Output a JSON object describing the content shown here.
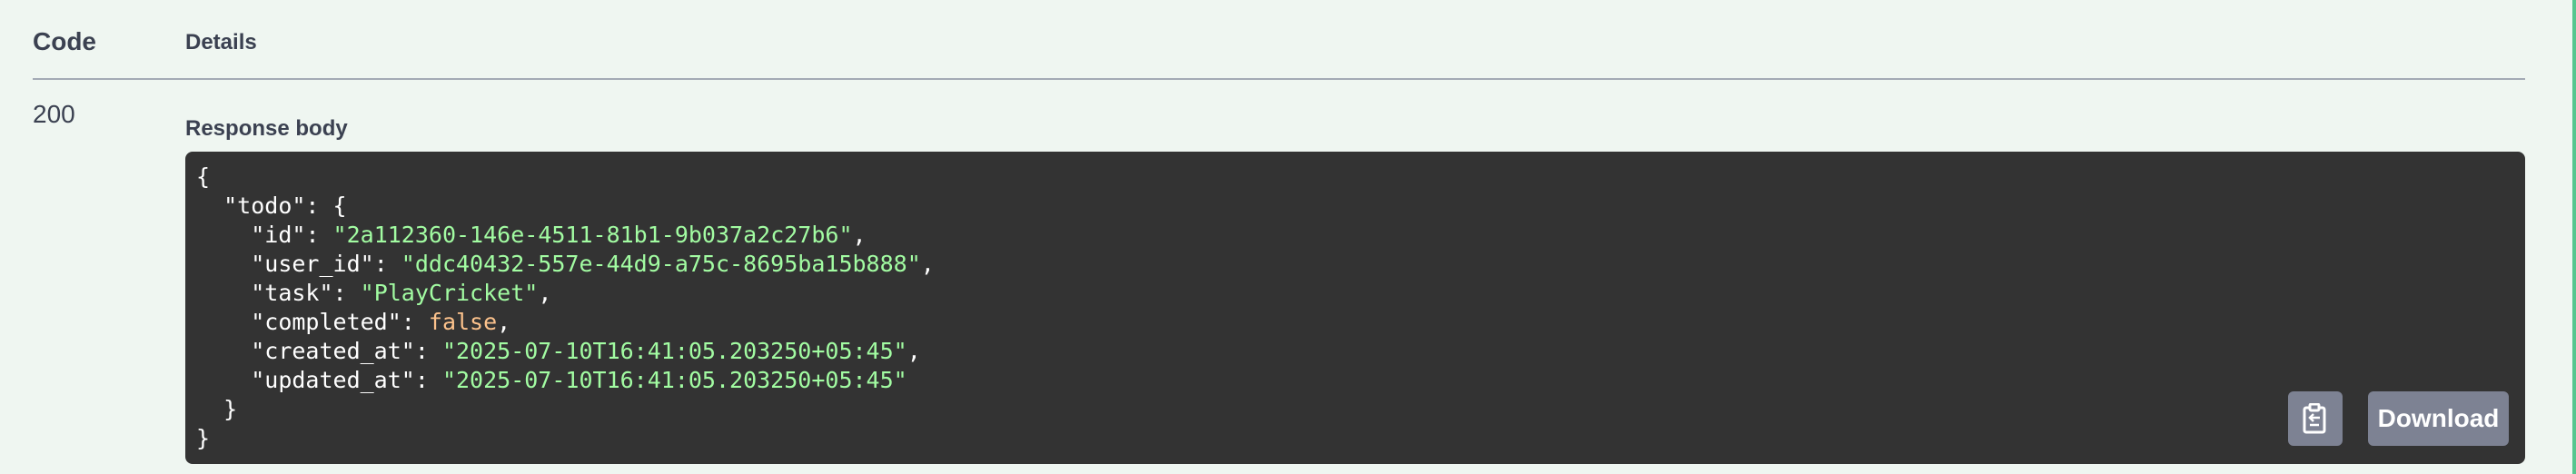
{
  "table": {
    "code_header": "Code",
    "details_header": "Details"
  },
  "response": {
    "status_code": "200",
    "body_label": "Response body",
    "lines": [
      {
        "indent": "",
        "key": "",
        "value": "",
        "value_type": "",
        "suffix": "{"
      },
      {
        "indent": "  ",
        "key": "\"todo\"",
        "value": "",
        "value_type": "",
        "suffix": ": {"
      },
      {
        "indent": "    ",
        "key": "\"id\"",
        "value": "\"2a112360-146e-4511-81b1-9b037a2c27b6\"",
        "value_type": "string",
        "suffix": ","
      },
      {
        "indent": "    ",
        "key": "\"user_id\"",
        "value": "\"ddc40432-557e-44d9-a75c-8695ba15b888\"",
        "value_type": "string",
        "suffix": ","
      },
      {
        "indent": "    ",
        "key": "\"task\"",
        "value": "\"PlayCricket\"",
        "value_type": "string",
        "suffix": ","
      },
      {
        "indent": "    ",
        "key": "\"completed\"",
        "value": "false",
        "value_type": "bool",
        "suffix": ","
      },
      {
        "indent": "    ",
        "key": "\"created_at\"",
        "value": "\"2025-07-10T16:41:05.203250+05:45\"",
        "value_type": "string",
        "suffix": ","
      },
      {
        "indent": "    ",
        "key": "\"updated_at\"",
        "value": "\"2025-07-10T16:41:05.203250+05:45\"",
        "value_type": "string",
        "suffix": ""
      },
      {
        "indent": "  ",
        "key": "",
        "value": "",
        "value_type": "",
        "suffix": "}"
      },
      {
        "indent": "",
        "key": "",
        "value": "",
        "value_type": "",
        "suffix": "}"
      }
    ]
  },
  "actions": {
    "copy_icon": "clipboard-copy-icon",
    "download_label": "Download"
  },
  "colors": {
    "background": "#eff6f1",
    "code_background": "#333333",
    "string_value": "#a2fca2",
    "bool_value": "#fcc28c",
    "button": "#7d8293",
    "accent_border": "#57c68f"
  }
}
